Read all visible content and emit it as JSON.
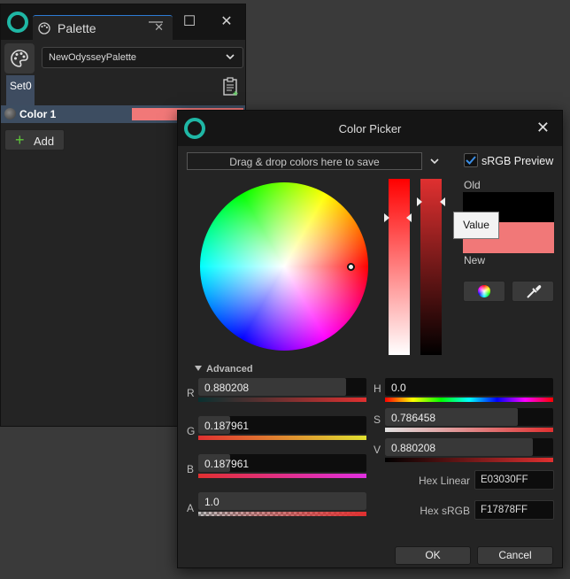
{
  "palette_window": {
    "tab_title": "Palette",
    "palette_select": "NewOdysseyPalette",
    "set_tab": "Set0",
    "color_item": {
      "label": "Color 1",
      "swatch": "#f17878"
    },
    "add_label": "Add",
    "window_controls": {
      "minimize": "—",
      "maximize": "☐",
      "close": "✕"
    }
  },
  "color_picker": {
    "title": "Color Picker",
    "dropzone_text": "Drag & drop colors here to save",
    "srgb_preview_label": "sRGB Preview",
    "srgb_preview_checked": true,
    "old_label": "Old",
    "new_label": "New",
    "old_color": "#000000",
    "new_color": "#f17878",
    "tooltip": "Value",
    "advanced_label": "Advanced",
    "channels_left": [
      {
        "letter": "R",
        "value": "0.880208",
        "fraction": 0.88
      },
      {
        "letter": "G",
        "value": "0.187961",
        "fraction": 0.19
      },
      {
        "letter": "B",
        "value": "0.187961",
        "fraction": 0.19
      },
      {
        "letter": "A",
        "value": "1.0",
        "fraction": 1.0
      }
    ],
    "channels_right": [
      {
        "letter": "H",
        "value": "0.0",
        "fraction": 0.0
      },
      {
        "letter": "S",
        "value": "0.786458",
        "fraction": 0.79
      },
      {
        "letter": "V",
        "value": "0.880208",
        "fraction": 0.88
      }
    ],
    "hex_linear_label": "Hex Linear",
    "hex_linear_value": "E03030FF",
    "hex_srgb_label": "Hex sRGB",
    "hex_srgb_value": "F17878FF",
    "ok_label": "OK",
    "cancel_label": "Cancel"
  },
  "colors": {
    "accent_teal": "#1fb7a5",
    "selection": "#3d4d61",
    "check_blue": "#2d7bd4"
  }
}
